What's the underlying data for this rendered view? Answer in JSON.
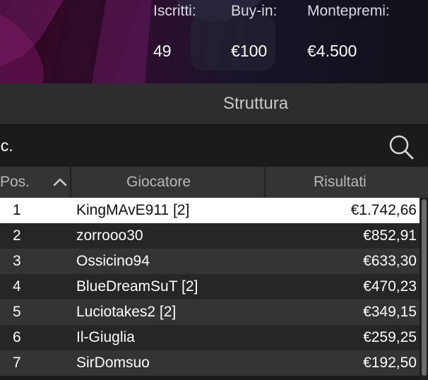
{
  "banner": {
    "stats": [
      {
        "label": "Iscritti:",
        "value": "49"
      },
      {
        "label": "Buy-in:",
        "value": "€100"
      },
      {
        "label": "Montepremi:",
        "value": "€4.500"
      }
    ]
  },
  "tabs": {
    "active": "Struttura"
  },
  "search": {
    "value": "oc.",
    "icon": "search-icon"
  },
  "table": {
    "columns": {
      "pos": "Pos.",
      "player": "Giocatore",
      "results": "Risultati"
    },
    "sort_icon": "chevron-up-icon",
    "rows": [
      {
        "pos": "1",
        "player": "KingMAvE911 [2]",
        "result": "€1.742,66"
      },
      {
        "pos": "2",
        "player": "zorrooo30",
        "result": "€852,91"
      },
      {
        "pos": "3",
        "player": "Ossicino94",
        "result": "€633,30"
      },
      {
        "pos": "4",
        "player": "BlueDreamSuT [2]",
        "result": "€470,23"
      },
      {
        "pos": "5",
        "player": "Luciotakes2 [2]",
        "result": "€349,15"
      },
      {
        "pos": "6",
        "player": "Il-Giuglia",
        "result": "€259,25"
      },
      {
        "pos": "7",
        "player": "SirDomsuo",
        "result": "€192,50"
      }
    ]
  },
  "colors": {
    "background": "#1b1b1b",
    "selected_row": "#ffffff",
    "header": "#343434",
    "banner_accent": "#7a1c6a"
  }
}
